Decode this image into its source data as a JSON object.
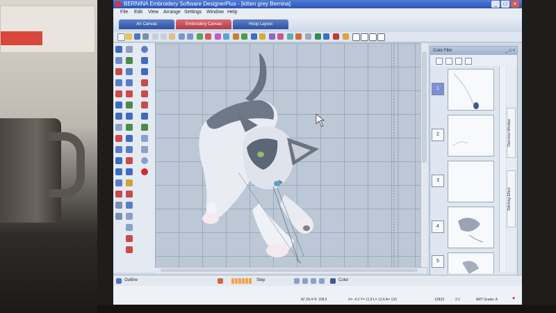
{
  "window": {
    "title": "BERNINA Embroidery Software DesignerPlus - [kitten grey     Bernina]",
    "controls": [
      "_",
      "□",
      "×"
    ]
  },
  "menu": [
    "File",
    "Edit",
    "View",
    "Arrange",
    "Settings",
    "Window",
    "Help"
  ],
  "mode_tabs": [
    "Art Canvas",
    "Embroidery Canvas",
    "Hoop Layout"
  ],
  "color_film": {
    "title": "Color Film",
    "controls": "_ □ ×",
    "entries": [
      {
        "number": "1",
        "selected": true
      },
      {
        "number": "2",
        "selected": false
      },
      {
        "number": "3",
        "selected": false
      },
      {
        "number": "4",
        "selected": false
      },
      {
        "number": "5",
        "selected": false
      }
    ],
    "side_tabs": [
      "Overview Window",
      "Stitching Effect"
    ]
  },
  "bottom_toolbar": {
    "outline_label": "Outline",
    "stitch_label": "Step",
    "color_label": "Color"
  },
  "status_bar": {
    "size": "W: 93.4  H: 108.9",
    "position": "X= -4.2  Y= 11.9  L= 12.6  A= 133",
    "stitches": "12833",
    "zoom": "2:1",
    "grade": "ART Grade: A"
  },
  "colors": {
    "accent": "#2c56b8",
    "embroidery_tab": "#b33b46",
    "canvas": "#bcc8d6",
    "heart": "#d32b2b"
  }
}
